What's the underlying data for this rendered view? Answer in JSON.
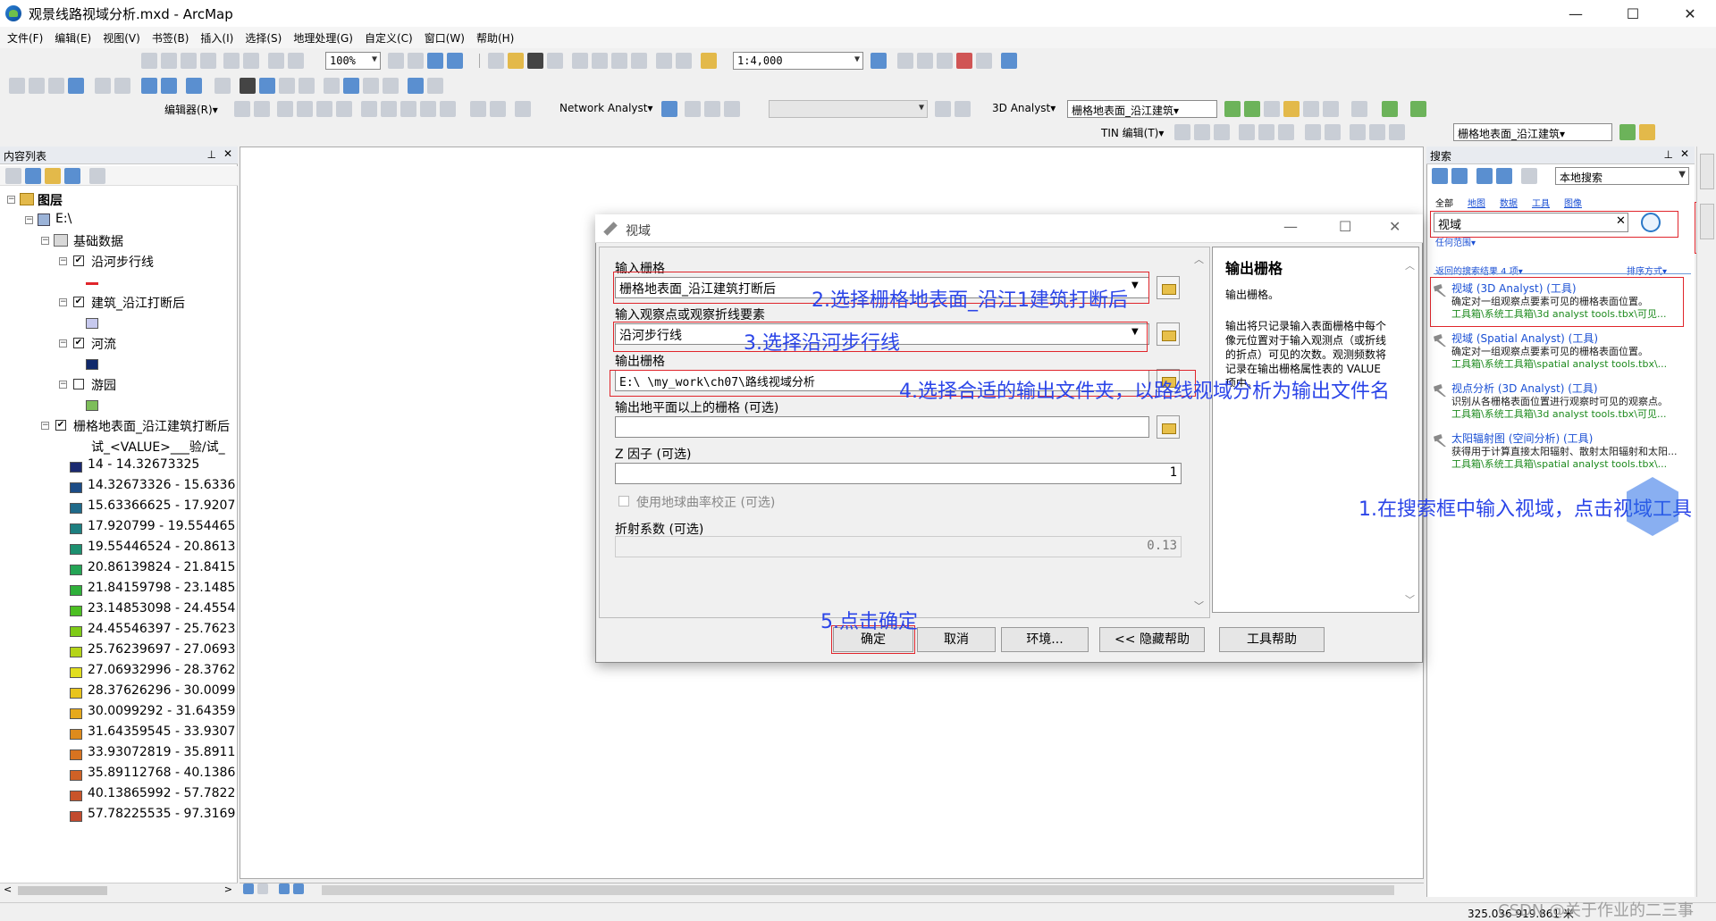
{
  "window": {
    "title": "观景线路视域分析.mxd - ArcMap",
    "min": "—",
    "max": "☐",
    "close": "✕"
  },
  "menu": [
    "文件(F)",
    "编辑(E)",
    "视图(V)",
    "书签(B)",
    "插入(I)",
    "选择(S)",
    "地理处理(G)",
    "自定义(C)",
    "窗口(W)",
    "帮助(H)"
  ],
  "toolbar": {
    "zoom_pct": "100%",
    "scale": "1:4,000",
    "editor": "编辑器(R)▾",
    "network_analyst": "Network Analyst▾",
    "analyst3d": "3D Analyst▾",
    "layer1": "栅格地表面_沿江建筑▾",
    "tin": "TIN 编辑(T)▾",
    "layer2": "栅格地表面_沿江建筑▾"
  },
  "toc": {
    "panel_title": "内容列表",
    "root": "图层",
    "folder": "E:\\",
    "group": "基础数据",
    "layers": [
      {
        "name": "沿河步行线",
        "checked": true,
        "color": "#e0252b",
        "kind": "line"
      },
      {
        "name": "建筑_沿江打断后",
        "checked": true,
        "color": "#c7c9ee",
        "kind": "fill"
      },
      {
        "name": "河流",
        "checked": true,
        "color": "#10296b",
        "kind": "fill"
      },
      {
        "name": "游园",
        "checked": false,
        "color": "#7dbd5a",
        "kind": "fill"
      }
    ],
    "raster": {
      "name": "栅格地表面_沿江建筑打断后",
      "sub": "试_<VALUE>___验/试_",
      "classes": [
        {
          "label": "14 - 14.32673325",
          "color": "#1b2a70"
        },
        {
          "label": "14.32673326 - 15.6336",
          "color": "#1c4c86"
        },
        {
          "label": "15.63366625 - 17.9207",
          "color": "#1f6a8a"
        },
        {
          "label": "17.920799 - 19.554465",
          "color": "#1d7f80"
        },
        {
          "label": "19.55446524 - 20.8613",
          "color": "#1d9070"
        },
        {
          "label": "20.86139824 - 21.8415",
          "color": "#24a455"
        },
        {
          "label": "21.84159798 - 23.1485",
          "color": "#2fb03a"
        },
        {
          "label": "23.14853098 - 24.4554",
          "color": "#4cbf22"
        },
        {
          "label": "24.45546397 - 25.7623",
          "color": "#7fcb16"
        },
        {
          "label": "25.76239697 - 27.0693",
          "color": "#b5d418"
        },
        {
          "label": "27.06932996 - 28.3762",
          "color": "#e1de1e"
        },
        {
          "label": "28.37626296 - 30.0099",
          "color": "#e8c41c"
        },
        {
          "label": "30.0099292 - 31.64359",
          "color": "#e6a91c"
        },
        {
          "label": "31.64359545 - 33.9307",
          "color": "#de8b1c"
        },
        {
          "label": "33.93072819 - 35.8911",
          "color": "#d87320"
        },
        {
          "label": "35.89112768 - 40.1386",
          "color": "#cf6126"
        },
        {
          "label": "40.13865992 - 57.7822",
          "color": "#c9542a"
        },
        {
          "label": "57.78225535 - 97.3169",
          "color": "#c24a2e"
        }
      ]
    }
  },
  "search": {
    "panel_title": "搜索",
    "scope": "本地搜索",
    "tabs": [
      "全部",
      "地图",
      "数据",
      "工具",
      "图像"
    ],
    "query": "视域",
    "range_link": "任何范围▾",
    "result_count": "返回的搜索结果 4 项▾",
    "sort": "排序方式▾",
    "results": [
      {
        "title": "视域 (3D Analyst) (工具)",
        "desc": "确定对一组观察点要素可见的栅格表面位置。",
        "path": "工具箱\\系统工具箱\\3d analyst tools.tbx\\可见..."
      },
      {
        "title": "视域 (Spatial Analyst) (工具)",
        "desc": "确定对一组观察点要素可见的栅格表面位置。",
        "path": "工具箱\\系统工具箱\\spatial analyst tools.tbx\\..."
      },
      {
        "title": "视点分析 (3D Analyst) (工具)",
        "desc": "识别从各栅格表面位置进行观察时可见的观察点。",
        "path": "工具箱\\系统工具箱\\3d analyst tools.tbx\\可见..."
      },
      {
        "title": "太阳辐射图 (空间分析) (工具)",
        "desc": "获得用于计算直接太阳辐射、散射太阳辐射和太阳...",
        "path": "工具箱\\系统工具箱\\spatial analyst tools.tbx\\..."
      }
    ]
  },
  "dialog": {
    "title": "视域",
    "input_raster_label": "输入栅格",
    "input_raster": "栅格地表面_沿江建筑打断后",
    "observer_label": "输入观察点或观察折线要素",
    "observer": "沿河步行线",
    "output_label": "输出栅格",
    "output": "E:\\          \\my_work\\ch07\\路线视域分析",
    "agl_label": "输出地平面以上的栅格 (可选)",
    "agl": "",
    "z_label": "Z 因子 (可选)",
    "z": "1",
    "curvature": "使用地球曲率校正 (可选)",
    "refraction_label": "折射系数 (可选)",
    "refraction": "0.13",
    "buttons": {
      "ok": "确定",
      "cancel": "取消",
      "env": "环境...",
      "hide": "<< 隐藏帮助",
      "toolhelp": "工具帮助"
    },
    "help_title": "输出栅格",
    "help_p1": "输出栅格。",
    "help_p2": "输出将只记录输入表面栅格中每个像元位置对于输入观测点（或折线的折点）可见的次数。观测频数将记录在输出栅格属性表的 VALUE 项中。"
  },
  "notes": {
    "n1": "1.在搜索框中输入视域，点击视域工具",
    "n2": "2.选择栅格地表面_沿江1建筑打断后",
    "n3": "3.选择沿河步行线",
    "n4": "4.选择合适的输出文件夹，以路线视域分析为输出文件名",
    "n5": "5.点击确定"
  },
  "status": {
    "coords": "325.036  919.861 米",
    "watermark": "CSDN @关于作业的二三事"
  }
}
